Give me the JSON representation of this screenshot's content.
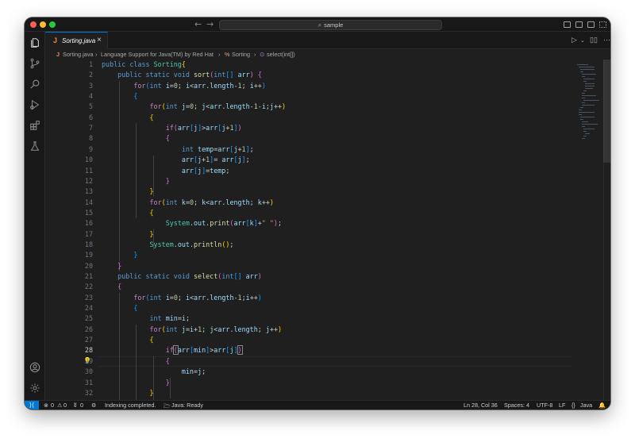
{
  "titlebar": {
    "search_text": "sample",
    "nav_back": "←",
    "nav_forward": "→"
  },
  "tab": {
    "icon": "J",
    "name": "Sorting.java",
    "close": "×"
  },
  "breadcrumb": {
    "file": "Sorting.java",
    "sep": "›",
    "ext": "Language Support for Java(TM) by Red Hat",
    "class": "Sorting",
    "method": "select(int[])"
  },
  "editor": {
    "active_line": 28,
    "line_numbers": [
      "1",
      "2",
      "3",
      "4",
      "5",
      "6",
      "7",
      "8",
      "9",
      "10",
      "11",
      "12",
      "13",
      "14",
      "15",
      "16",
      "17",
      "18",
      "19",
      "20",
      "21",
      "22",
      "23",
      "24",
      "25",
      "26",
      "27",
      "28",
      "29",
      "30",
      "31",
      "32"
    ]
  },
  "statusbar": {
    "errors": "0",
    "warnings": "0",
    "ports": "0",
    "indexing": "Indexing completed.",
    "java_status": "Java: Ready",
    "position": "Ln 28, Col 36",
    "spaces": "Spaces: 4",
    "encoding": "UTF-8",
    "eol": "LF",
    "language": "Java"
  },
  "icons": {
    "activity": [
      "files-icon",
      "source-control-icon",
      "search-icon",
      "run-debug-icon",
      "extensions-icon",
      "testing-icon",
      "account-icon",
      "settings-gear-icon"
    ]
  },
  "colors": {
    "accent": "#0078d4",
    "editor_bg": "#1f1f1f",
    "chrome_bg": "#181818"
  }
}
